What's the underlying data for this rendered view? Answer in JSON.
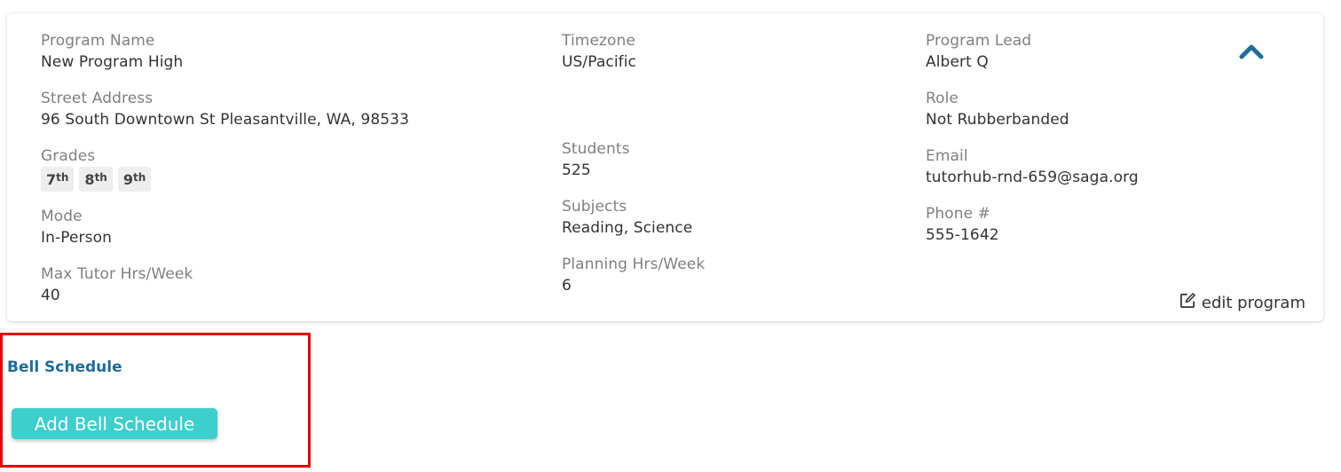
{
  "program": {
    "name_label": "Program Name",
    "name": "New Program High",
    "address_label": "Street Address",
    "address": "96 South Downtown St Pleasantville, WA, 98533",
    "grades_label": "Grades",
    "grades": [
      {
        "num": "7",
        "suffix": "th"
      },
      {
        "num": "8",
        "suffix": "th"
      },
      {
        "num": "9",
        "suffix": "th"
      }
    ],
    "mode_label": "Mode",
    "mode": "In-Person",
    "max_tutor_label": "Max Tutor Hrs/Week",
    "max_tutor": "40",
    "timezone_label": "Timezone",
    "timezone": "US/Pacific",
    "students_label": "Students",
    "students": "525",
    "subjects_label": "Subjects",
    "subjects": "Reading, Science",
    "planning_label": "Planning Hrs/Week",
    "planning": "6",
    "lead_label": "Program Lead",
    "lead": "Albert Q",
    "role_label": "Role",
    "role": "Not Rubberbanded",
    "email_label": "Email",
    "email": "tutorhub-rnd-659@saga.org",
    "phone_label": "Phone #",
    "phone": "555-1642",
    "edit_label": "edit program"
  },
  "bell_schedule": {
    "title": "Bell Schedule",
    "add_button": "Add Bell Schedule"
  },
  "colors": {
    "accent_blue": "#1e6e96",
    "button_teal": "#3dcfcc",
    "highlight_red": "#e00000"
  },
  "icons": {
    "collapse": "chevron-up-icon",
    "edit": "edit-icon"
  }
}
